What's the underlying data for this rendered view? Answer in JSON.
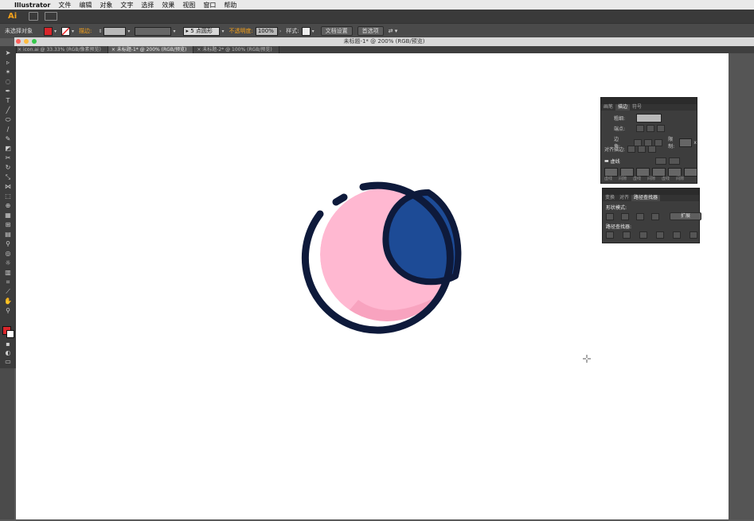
{
  "menubar": {
    "app_name": "Illustrator",
    "items": [
      "文件",
      "编辑",
      "对象",
      "文字",
      "选择",
      "效果",
      "视图",
      "窗口",
      "帮助"
    ]
  },
  "appbar": {
    "logo": "Ai"
  },
  "controlbar": {
    "selection_label": "未选择对象",
    "fill_color": "#d9262b",
    "stroke_label": "描边:",
    "brush_label": "5 点圆形",
    "opacity_label": "不透明度:",
    "opacity_value": "100%",
    "style_label": "样式:",
    "doc_setup_label": "文档设置",
    "prefs_label": "首选项"
  },
  "window": {
    "title": "未标题-1* @ 200% (RGB/预览)"
  },
  "tabs": [
    {
      "label": "icon.ai @ 33.33% (RGB/像素预览)"
    },
    {
      "label": "未标题-1* @ 200% (RGB/预览)"
    },
    {
      "label": "未标题-2* @ 100% (RGB/预览)"
    }
  ],
  "stroke_panel": {
    "tabs": [
      "画笔",
      "描边",
      "符号"
    ],
    "weight_label": "粗细:",
    "cap_label": "端点:",
    "corner_label": "边角:",
    "limit_label": "限制:",
    "limit_unit": "x",
    "align_label": "对齐描边:",
    "dashed_label": "虚线",
    "dash_labels": [
      "虚线",
      "间隙",
      "虚线",
      "间隙",
      "虚线",
      "间隙"
    ]
  },
  "pathfinder_panel": {
    "tabs": [
      "变换",
      "对齐",
      "路径查找器"
    ],
    "shape_modes_label": "形状模式:",
    "expand_label": "扩展",
    "pathfinders_label": "路径查找器:"
  },
  "colors": {
    "moon_pink": "#ffb8d1",
    "moon_shadow": "#f59ab8",
    "moon_blue": "#1d4b96",
    "outline": "#0e1a3b",
    "ai_orange": "#f7a21b"
  }
}
